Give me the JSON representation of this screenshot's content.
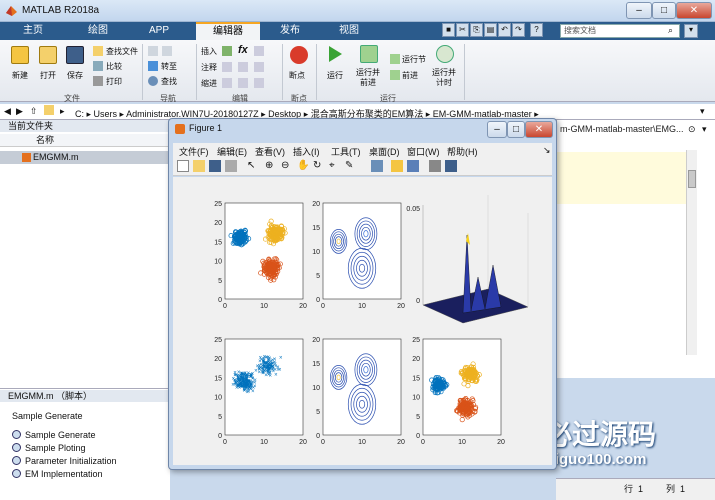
{
  "window": {
    "title": "MATLAB R2018a"
  },
  "tabs": [
    {
      "label": "主页"
    },
    {
      "label": "绘图"
    },
    {
      "label": "APP"
    },
    {
      "label": "编辑器"
    },
    {
      "label": "发布"
    },
    {
      "label": "视图"
    }
  ],
  "search": {
    "placeholder": "搜索文档"
  },
  "ribbon": {
    "new": "新建",
    "open": "打开",
    "save": "保存",
    "find_files": "查找文件",
    "compare": "比较",
    "print": "打印",
    "goto": "转至",
    "find": "查找",
    "insert": "插入",
    "comment": "注释",
    "indent": "缩进",
    "breakpoints": "断点",
    "run": "运行",
    "run_advance": "运行并\n前进",
    "run_section": "运行节",
    "advance": "前进",
    "run_time": "运行并\n计时",
    "groups": {
      "file": "文件",
      "nav": "导航",
      "edit": "编辑",
      "bp": "断点",
      "run": "运行"
    }
  },
  "address": {
    "drive": "C:",
    "segments": [
      "Users",
      "Administrator.WIN7U-20180127Z",
      "Desktop",
      "混合高斯分布聚类的EM算法",
      "EM-GMM-matlab-master"
    ]
  },
  "left_panel": {
    "header": "当前文件夹",
    "col_name": "名称",
    "file": "EMGMM.m"
  },
  "detail": {
    "header": "EMGMM.m （脚本）",
    "title": "Sample Generate",
    "items": [
      "Sample Generate",
      "Sample Ploting",
      "Parameter Initialization",
      "EM Implementation"
    ]
  },
  "editor": {
    "tab_text": "m-GMM-matlab-master\\EMG..."
  },
  "status": {
    "row_label": "行",
    "row": "1",
    "col_label": "列",
    "col": "1"
  },
  "figure": {
    "title": "Figure 1",
    "menus": [
      "文件(F)",
      "编辑(E)",
      "查看(V)",
      "插入(I)",
      "工具(T)",
      "桌面(D)",
      "窗口(W)",
      "帮助(H)"
    ],
    "plots": [
      {
        "name": "scatter-clusters",
        "yticks": [
          "25",
          "20",
          "15",
          "10",
          "5",
          "0"
        ],
        "xticks": [
          "0",
          "10",
          "20"
        ]
      },
      {
        "name": "contour",
        "yticks": [
          "20",
          "15",
          "10",
          "5",
          "0"
        ],
        "xticks": [
          "0",
          "10",
          "20"
        ]
      },
      {
        "name": "surface-3d",
        "zticks": [
          "0.05",
          "0"
        ]
      },
      {
        "name": "scatter-raw",
        "yticks": [
          "25",
          "20",
          "15",
          "10",
          "5",
          "0"
        ],
        "xticks": [
          "0",
          "10",
          "20"
        ]
      },
      {
        "name": "contour-2",
        "yticks": [
          "20",
          "15",
          "10",
          "5",
          "0"
        ],
        "xticks": [
          "0",
          "10",
          "20"
        ]
      },
      {
        "name": "scatter-result",
        "yticks": [
          "25",
          "20",
          "15",
          "10",
          "5",
          "0"
        ],
        "xticks": [
          "0",
          "10",
          "20"
        ]
      }
    ]
  },
  "watermark": {
    "cn": "必过源码",
    "en": "Biguo100.com"
  },
  "colors": {
    "blue": "#0072bd",
    "orange": "#d95319",
    "yellow": "#edb120",
    "tabbar": "#2b5b8c"
  }
}
